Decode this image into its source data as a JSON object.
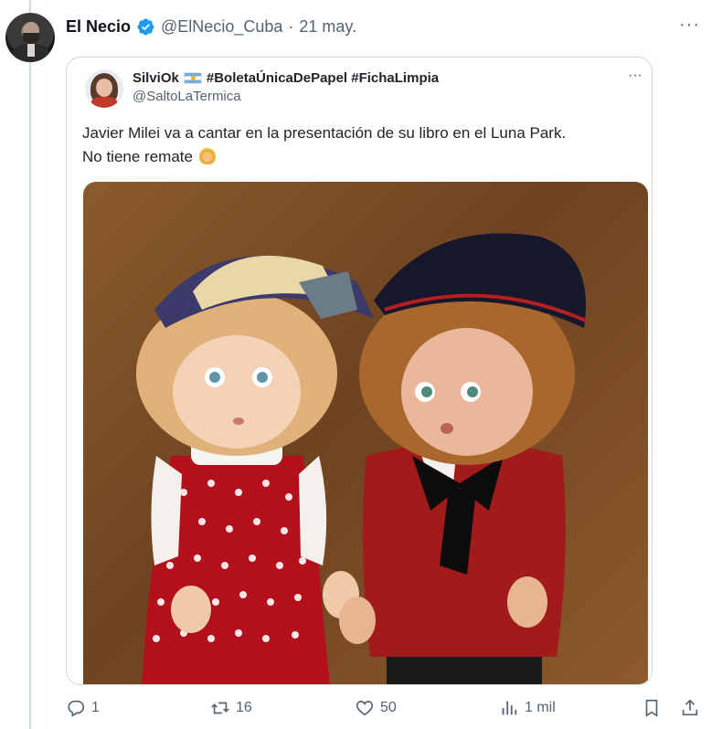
{
  "tweet": {
    "author_name": "El Necio",
    "author_handle": "@ElNecio_Cuba",
    "separator": "·",
    "date": "21 may.",
    "more_label": "···"
  },
  "quoted": {
    "author_name": "SilviOk",
    "author_tags": "#BoletaÚnicaDePapel #FichaLimpia",
    "author_handle": "@SaltoLaTermica",
    "more_label": "···",
    "text_line1": "Javier Milei va a cantar en la presentación de su libro en el Luna Park.",
    "text_line2": "No tiene remate"
  },
  "actions": {
    "replies": "1",
    "retweets": "16",
    "likes": "50",
    "views": "1 mil"
  },
  "colors": {
    "verified": "#1d9bf0",
    "secondary_text": "#536471",
    "border": "#cfd9de"
  },
  "icons": {
    "verified": "verified-badge-icon",
    "reply": "reply-icon",
    "retweet": "retweet-icon",
    "like": "heart-icon",
    "views": "views-icon",
    "bookmark": "bookmark-icon",
    "share": "share-icon"
  }
}
